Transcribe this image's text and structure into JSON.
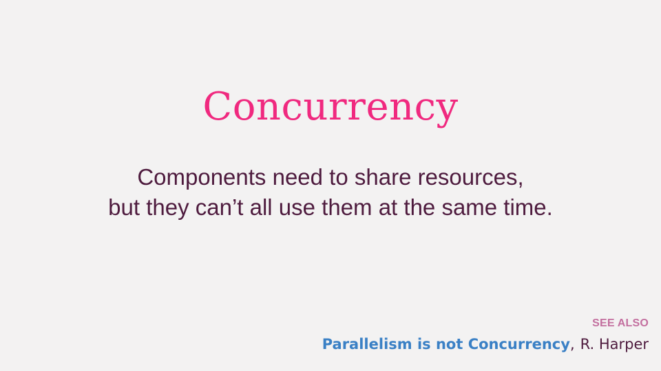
{
  "slide": {
    "title": "Concurrency",
    "body_lines": [
      "Components need to share resources,",
      "but they can’t all use them at the same time."
    ],
    "see_also": {
      "label": "SEE ALSO",
      "reference_title": "Parallelism is not Concurrency",
      "separator": ",",
      "author": "R. Harper"
    },
    "colors": {
      "background": "#f3f2f2",
      "title": "#f0297f",
      "body": "#4e1b3e",
      "see_also_label": "#c36f9f",
      "link": "#3a80c5"
    }
  }
}
